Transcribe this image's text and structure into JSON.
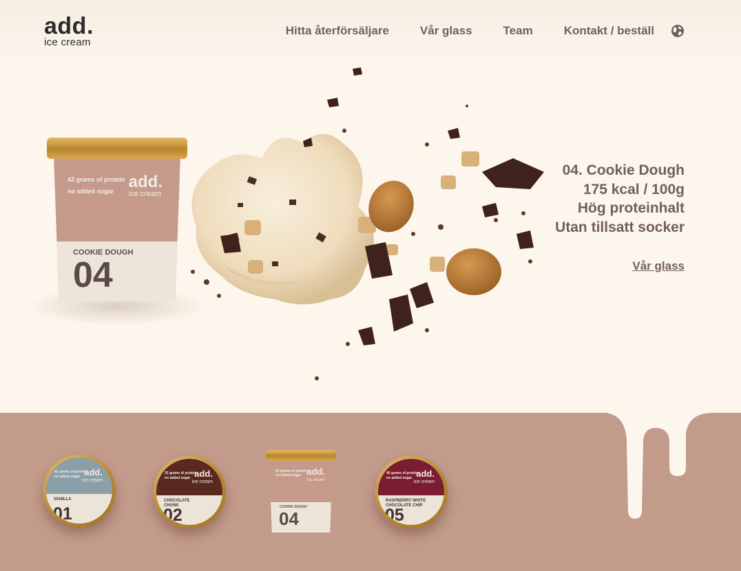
{
  "header": {
    "logo_main": "add.",
    "logo_sub": "ice cream",
    "nav": [
      "Hitta återförsäljare",
      "Vår glass",
      "Team",
      "Kontakt / beställ"
    ],
    "language_icon": "globe-icon"
  },
  "hero": {
    "title": "04. Cookie Dough",
    "kcal": "175 kcal / 100g",
    "protein": "Hög proteinhalt",
    "sugar": "Utan tillsatt socker",
    "link": "Vår glass",
    "tub": {
      "brand": "add.",
      "brand_sub": "ice cream",
      "claim_protein_num": "42",
      "claim_protein": "grams of protein",
      "claim_sugar": "no added sugar",
      "flavor": "COOKIE DOUGH",
      "number": "04"
    }
  },
  "products": [
    {
      "number": "01",
      "flavor": "VANILLA",
      "color": "#8b9fa8"
    },
    {
      "number": "02",
      "flavor": "CHOCOLATE CHUNK",
      "color": "#5a2a21"
    },
    {
      "number": "04",
      "flavor": "COOKIE DOUGH",
      "color": "#c59a8a"
    },
    {
      "number": "05",
      "flavor": "RASPBERRY WHITE CHOCOLATE CHIP",
      "color": "#7a1d31"
    }
  ],
  "colors": {
    "background": "#fdf6ec",
    "accent": "#c39b8b",
    "text": "#725e5e"
  }
}
